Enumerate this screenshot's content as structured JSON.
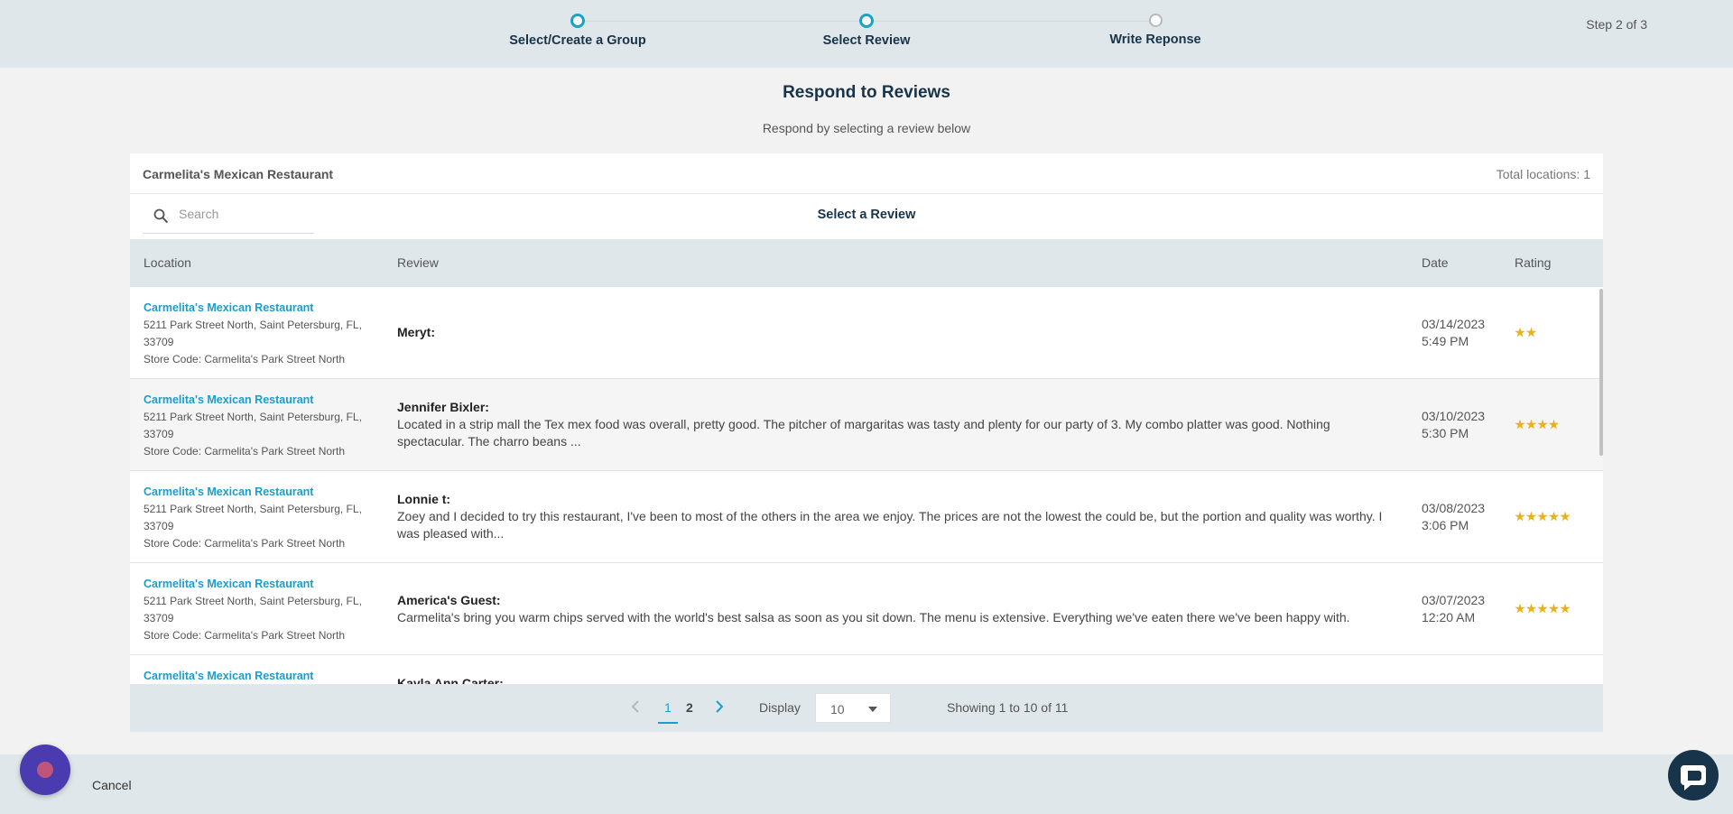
{
  "stepper": {
    "steps": [
      {
        "label": "Select/Create a Group",
        "state": "completed"
      },
      {
        "label": "Select Review",
        "state": "active"
      },
      {
        "label": "Write Reponse",
        "state": "inactive"
      }
    ],
    "count": "Step 2 of 3"
  },
  "page": {
    "title": "Respond to Reviews",
    "subtitle": "Respond by selecting a review below"
  },
  "card": {
    "restaurant_name": "Carmelita's Mexican Restaurant",
    "total_locations": "Total locations: 1",
    "search_placeholder": "Search",
    "select_title": "Select a Review"
  },
  "table": {
    "columns": [
      "Location",
      "Review",
      "Date",
      "Rating"
    ],
    "rows": [
      {
        "location_name": "Carmelita's Mexican Restaurant",
        "address": "5211 Park Street North, Saint Petersburg, FL, 33709",
        "store_code": "Store Code: Carmelita's Park Street North",
        "author": "Meryt:",
        "text": "",
        "date": "03/14/2023",
        "time": "5:49 PM",
        "rating": 2
      },
      {
        "location_name": "Carmelita's Mexican Restaurant",
        "address": "5211 Park Street North, Saint Petersburg, FL, 33709",
        "store_code": "Store Code: Carmelita's Park Street North",
        "author": "Jennifer Bixler:",
        "text": "Located in a strip mall the Tex mex food was overall, pretty good. The pitcher of margaritas was tasty and plenty for our party of 3. My combo platter was good. Nothing spectacular. The charro beans ...",
        "date": "03/10/2023",
        "time": "5:30 PM",
        "rating": 4
      },
      {
        "location_name": "Carmelita's Mexican Restaurant",
        "address": "5211 Park Street North, Saint Petersburg, FL, 33709",
        "store_code": "Store Code: Carmelita's Park Street North",
        "author": "Lonnie t:",
        "text": "Zoey and I decided to try this restaurant, I've been to most of the others in the area we enjoy. The prices are not the lowest the could be, but the portion and quality was worthy. I was pleased with...",
        "date": "03/08/2023",
        "time": "3:06 PM",
        "rating": 5
      },
      {
        "location_name": "Carmelita's Mexican Restaurant",
        "address": "5211 Park Street North, Saint Petersburg, FL, 33709",
        "store_code": "Store Code: Carmelita's Park Street North",
        "author": "America's Guest:",
        "text": "Carmelita's bring you warm chips served with the world's best salsa as soon as you sit down. The menu is extensive. Everything we've eaten there we've been happy with.",
        "date": "03/07/2023",
        "time": "12:20 AM",
        "rating": 5
      },
      {
        "location_name": "Carmelita's Mexican Restaurant",
        "address": "",
        "store_code": "",
        "author": "Kayla Ann Carter:",
        "text": "",
        "date": "",
        "time": "",
        "rating": 0
      }
    ]
  },
  "pagination": {
    "pages": [
      "1",
      "2"
    ],
    "current": "1",
    "display_label": "Display",
    "display_value": "10",
    "showing": "Showing 1 to 10 of 11"
  },
  "footer": {
    "cancel_label": "Cancel"
  },
  "colors": {
    "accent": "#1ba3c6",
    "link": "#1b9ccf",
    "header_bg": "#e0e7ea",
    "title": "#17344a",
    "star": "#e8b319",
    "logo_button": "#4a3bb0",
    "chat_button": "#17344a"
  },
  "icons": {
    "search": "search-icon",
    "prev": "chevron-left-icon",
    "next": "chevron-right-icon",
    "caret": "caret-down-icon",
    "chat": "chat-bubble-icon"
  }
}
